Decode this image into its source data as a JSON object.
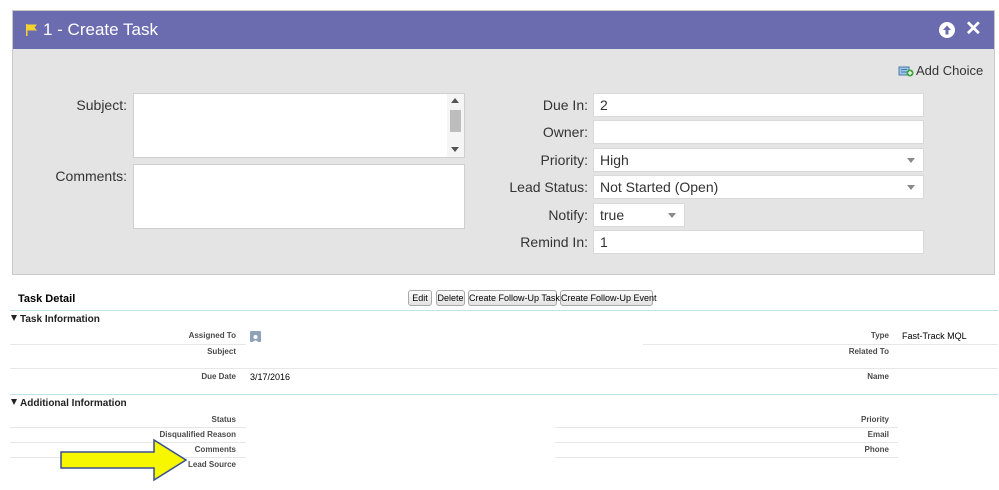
{
  "dialog": {
    "title": "1 - Create Task",
    "add_choice": "Add Choice",
    "labels": {
      "subject": "Subject:",
      "comments": "Comments:",
      "due_in": "Due In:",
      "owner": "Owner:",
      "priority": "Priority:",
      "lead_status": "Lead Status:",
      "notify": "Notify:",
      "remind_in": "Remind In:"
    },
    "values": {
      "subject": "",
      "comments": "",
      "due_in": "2",
      "owner": "",
      "priority": "High",
      "lead_status": "Not Started (Open)",
      "notify": "true",
      "remind_in": "1"
    }
  },
  "task_detail": {
    "title": "Task Detail",
    "buttons": [
      "Edit",
      "Delete",
      "Create Follow-Up Task",
      "Create Follow-Up Event"
    ],
    "task_information": {
      "heading": "Task Information",
      "assigned_to": "Assigned To",
      "subject": "Subject",
      "due_date": "Due Date",
      "due_date_value": "3/17/2016",
      "type": "Type",
      "type_value": "Fast-Track MQL",
      "related_to": "Related To",
      "name": "Name"
    },
    "additional_information": {
      "heading": "Additional Information",
      "status": "Status",
      "disqualified_reason": "Disqualified Reason",
      "comments": "Comments",
      "lead_source": "Lead Source",
      "priority": "Priority",
      "email": "Email",
      "phone": "Phone"
    }
  },
  "colors": {
    "header": "#6b6bb0",
    "panel_bg": "#e4e4e4",
    "section_line": "#bfe3ea",
    "arrow_fill": "#f7f700",
    "arrow_stroke": "#3b4f8c"
  },
  "icons": [
    "flag-icon",
    "arrow-up-icon",
    "close-icon",
    "add-choice-icon",
    "user-icon",
    "arrow-annotation"
  ]
}
